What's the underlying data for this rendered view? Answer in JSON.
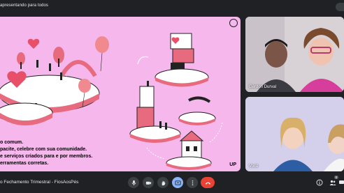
{
  "header": {
    "presenting_text": "apresentando para todos"
  },
  "slide": {
    "text_lines": [
      "o comum.",
      "pacite, celebre com sua comunidade.",
      "e serviços criados para e por membros.",
      "erramentas corretas."
    ],
    "logo_text": "UP"
  },
  "participants": [
    {
      "name": "Gérdon Durval"
    },
    {
      "name": "Você"
    }
  ],
  "footer": {
    "meeting_title": "o Fechamento Trimestral - FiosAosPés",
    "people_count": "3"
  },
  "colors": {
    "slide_bg": "#f6b7ec",
    "accent_red": "#ea4335",
    "accent_blue": "#8ab4f8",
    "toolbar_bg": "#3c4043",
    "app_bg": "#202124"
  },
  "icons": {
    "mic": "mic-icon",
    "camera": "camera-icon",
    "hand": "raise-hand-icon",
    "present": "present-screen-icon",
    "more": "more-options-icon",
    "end": "end-call-icon",
    "info": "info-icon",
    "people": "people-icon",
    "chat": "chat-icon"
  }
}
